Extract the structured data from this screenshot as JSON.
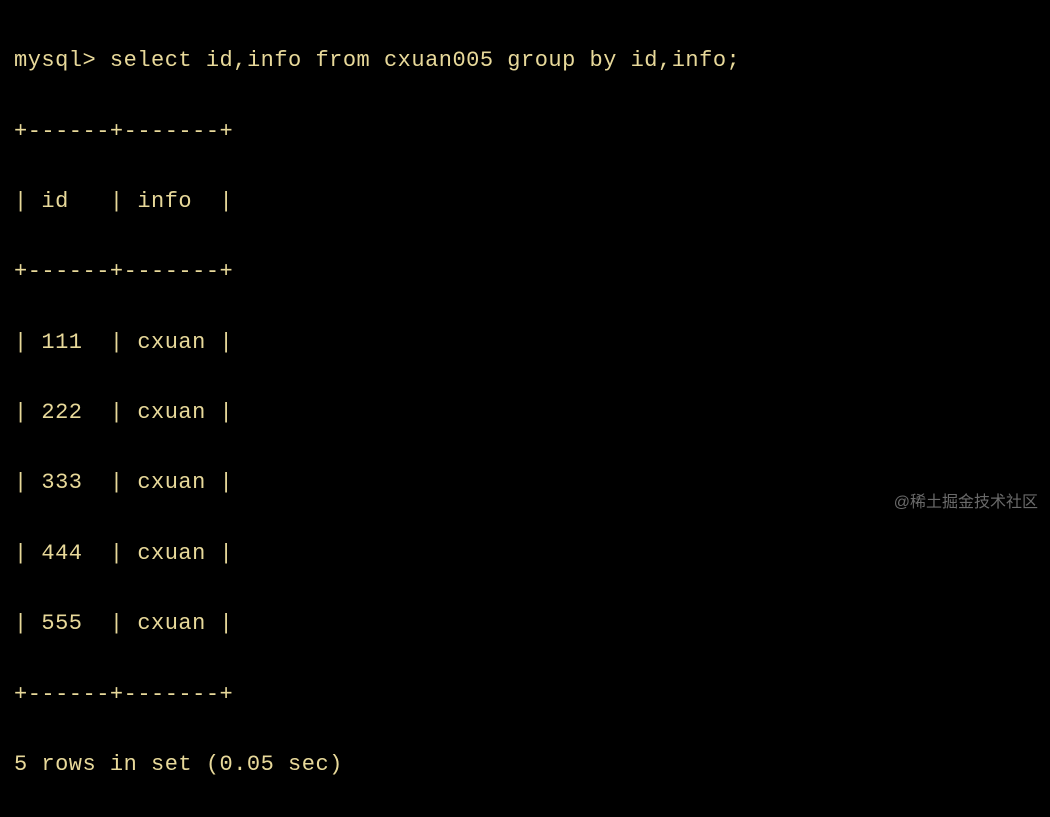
{
  "terminal": {
    "prompt": "mysql> ",
    "query": "select id,info from cxuan005 group by id,info;",
    "border_top": "+------+-------+",
    "header_row": "| id   | info  |",
    "border_mid": "+------+-------+",
    "rows": [
      "| 111  | cxuan |",
      "| 222  | cxuan |",
      "| 333  | cxuan |",
      "| 444  | cxuan |",
      "| 555  | cxuan |"
    ],
    "border_bottom": "+------+-------+",
    "status": "5 rows in set (0.05 sec)"
  },
  "chart_data": {
    "type": "table",
    "columns": [
      "id",
      "info"
    ],
    "rows": [
      {
        "id": 111,
        "info": "cxuan"
      },
      {
        "id": 222,
        "info": "cxuan"
      },
      {
        "id": 333,
        "info": "cxuan"
      },
      {
        "id": 444,
        "info": "cxuan"
      },
      {
        "id": 555,
        "info": "cxuan"
      }
    ],
    "row_count": 5,
    "elapsed_sec": 0.05
  },
  "watermark": "@稀土掘金技术社区"
}
